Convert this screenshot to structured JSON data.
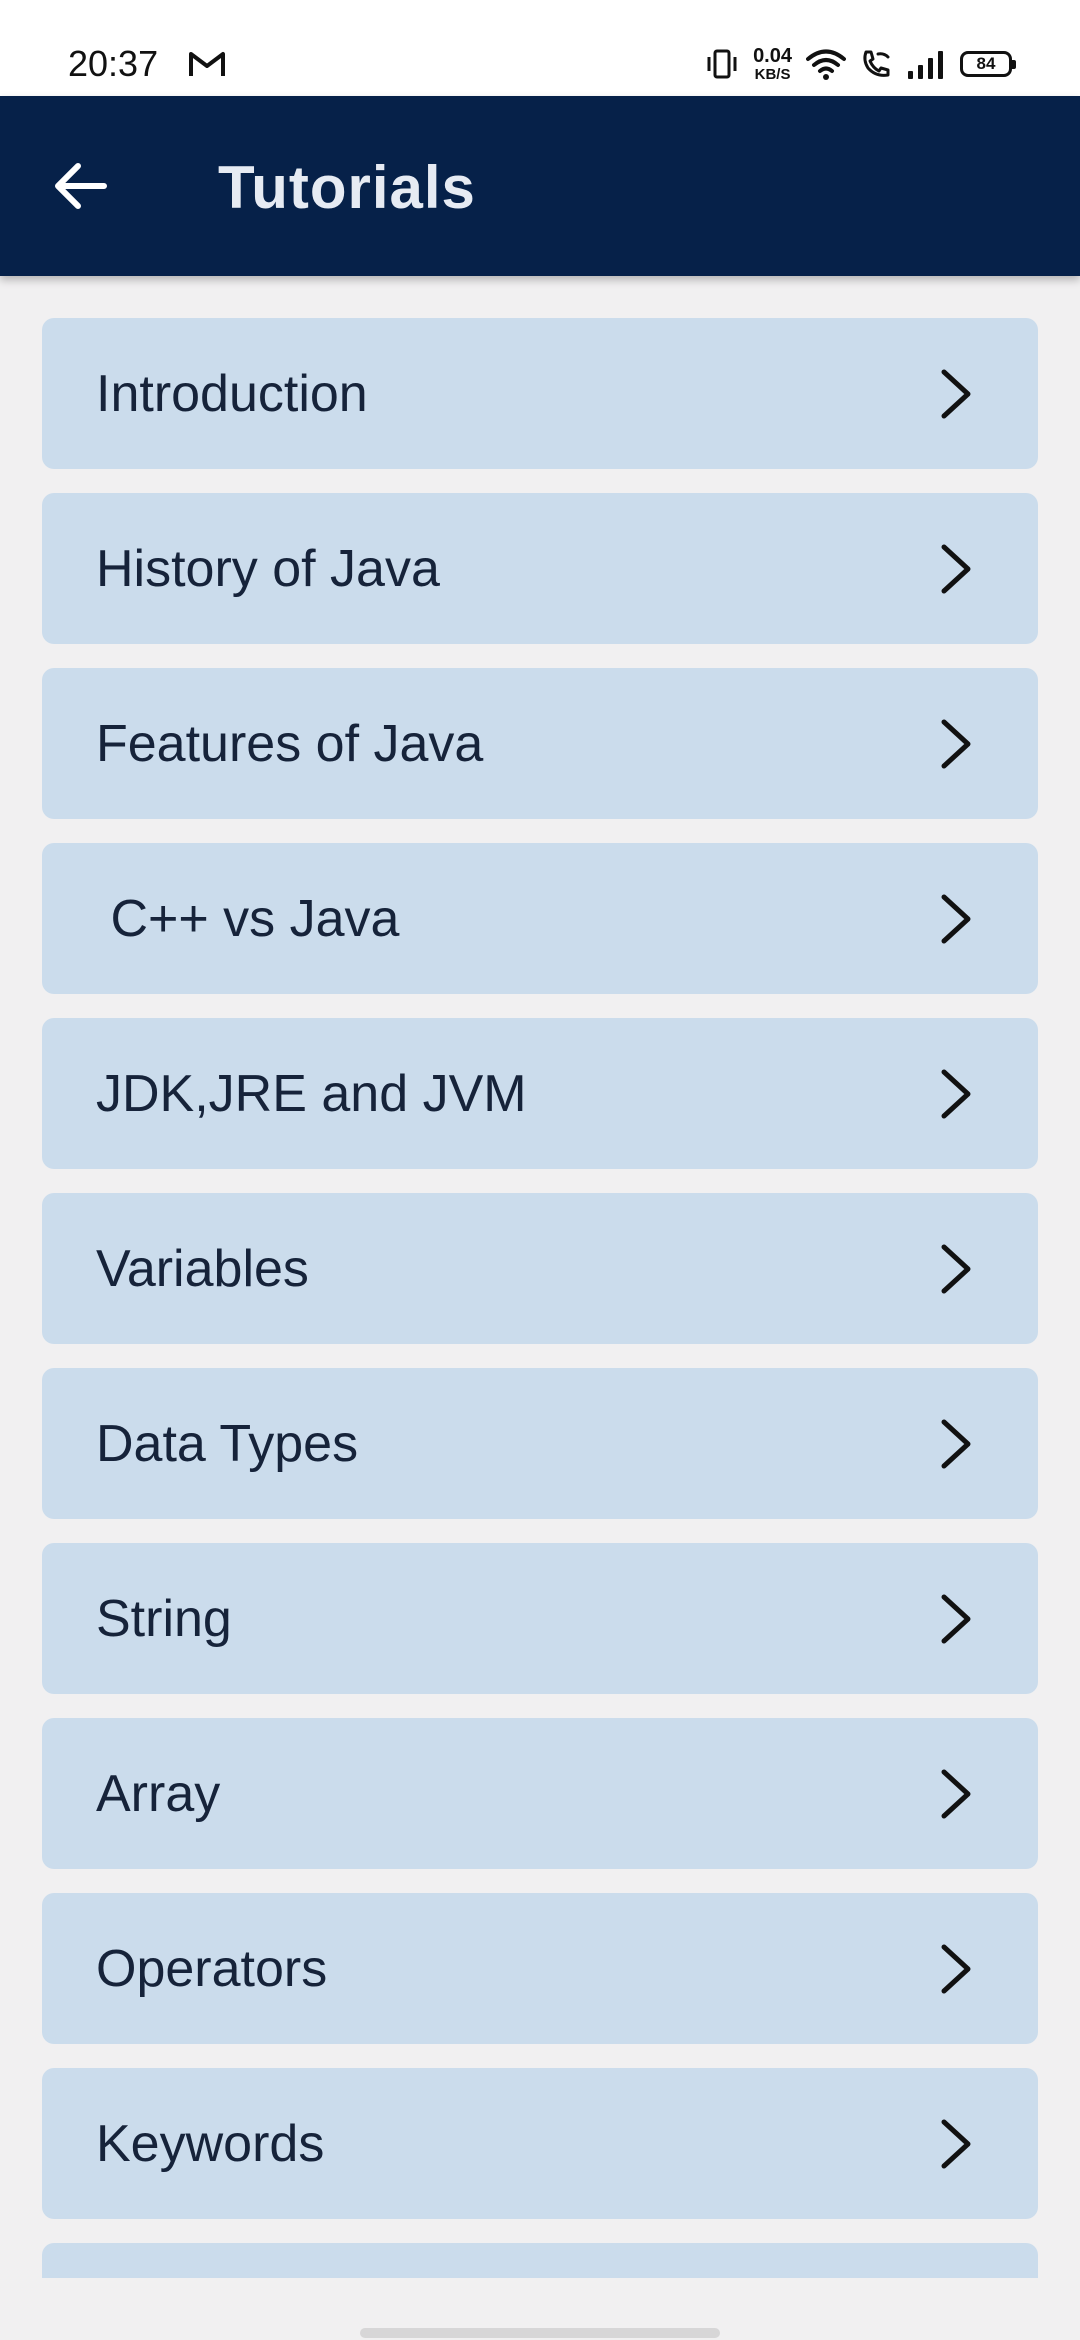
{
  "status_bar": {
    "time": "20:37",
    "net_speed_value": "0.04",
    "net_speed_unit": "KB/S",
    "battery": "84",
    "icons": [
      "gmail-icon",
      "vibrate-icon",
      "wifi-icon",
      "wifi-call-icon",
      "signal-icon",
      "battery-icon"
    ]
  },
  "appbar": {
    "title": "Tutorials",
    "back_icon": "arrow-left-icon",
    "background": "#062149"
  },
  "list": {
    "item_background": "#cbdcec",
    "chevron_icon": "chevron-right-icon",
    "items": [
      {
        "label": "Introduction"
      },
      {
        "label": "History of Java"
      },
      {
        "label": "Features of Java"
      },
      {
        "label": " C++ vs Java"
      },
      {
        "label": "JDK,JRE and JVM"
      },
      {
        "label": "Variables"
      },
      {
        "label": "Data Types"
      },
      {
        "label": "String"
      },
      {
        "label": "Array"
      },
      {
        "label": "Operators"
      },
      {
        "label": "Keywords"
      },
      {
        "label": ""
      }
    ]
  }
}
